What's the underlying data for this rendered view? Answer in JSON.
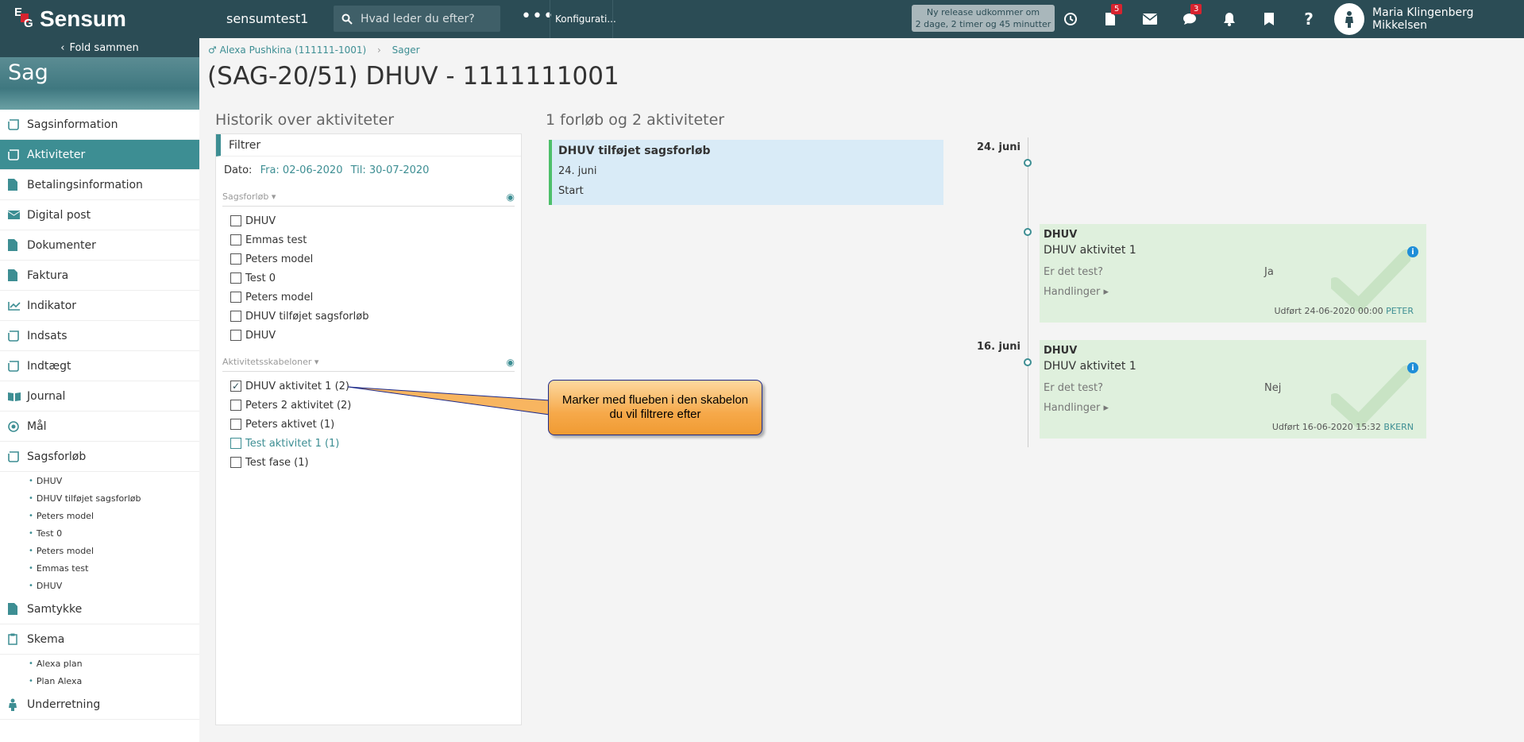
{
  "app": {
    "name": "Sensum",
    "tenant": "sensumtest1"
  },
  "topbar": {
    "search_placeholder": "Hvad leder du efter?",
    "more": "•••",
    "konfig": "Konfigurati...",
    "release_line1": "Ny release udkommer om",
    "release_line2": "2 dage, 2 timer og 45 minutter",
    "tasks_badge": "5",
    "chat_badge": "3",
    "user_name": "Maria Klingenberg Mikkelsen"
  },
  "sidebar": {
    "fold_label": "Fold sammen",
    "banner_title": "Sag",
    "items": [
      {
        "label": "Sagsinformation"
      },
      {
        "label": "Aktiviteter"
      },
      {
        "label": "Betalingsinformation"
      },
      {
        "label": "Digital post"
      },
      {
        "label": "Dokumenter"
      },
      {
        "label": "Faktura"
      },
      {
        "label": "Indikator"
      },
      {
        "label": "Indsats"
      },
      {
        "label": "Indtægt"
      },
      {
        "label": "Journal"
      },
      {
        "label": "Mål"
      },
      {
        "label": "Sagsforløb"
      },
      {
        "label": "Samtykke"
      },
      {
        "label": "Skema"
      },
      {
        "label": "Underretning"
      }
    ],
    "sagsforlob_sub": [
      "DHUV",
      "DHUV tilføjet sagsforløb",
      "Peters model",
      "Test 0",
      "Peters model",
      "Emmas test",
      "DHUV"
    ],
    "skema_sub": [
      "Alexa plan",
      "Plan Alexa"
    ]
  },
  "breadcrumb": {
    "person": "Alexa Pushkina (111111-1001)",
    "section": "Sager"
  },
  "page_title": "(SAG-20/51) DHUV - 1111111001",
  "history": {
    "title": "Historik over aktiviteter",
    "filter_label": "Filtrer",
    "dato_label": "Dato:",
    "dato_from": "Fra: 02-06-2020",
    "dato_to": "Til: 30-07-2020",
    "sagsforlob_header": "Sagsforløb",
    "sagsforlob_items": [
      "DHUV",
      "Emmas test",
      "Peters model",
      "Test 0",
      "Peters model",
      "DHUV tilføjet sagsforløb",
      "DHUV"
    ],
    "skabeloner_header": "Aktivitetsskabeloner",
    "skabeloner_items": [
      "DHUV aktivitet 1 (2)",
      "Peters 2 aktivitet (2)",
      "Peters aktivet (1)",
      "Test aktivitet 1 (1)",
      "Test fase (1)"
    ]
  },
  "callout": {
    "text": "Marker med flueben i den skabelon du vil filtrere efter"
  },
  "timeline": {
    "summary": "1 forløb og 2 aktiviteter",
    "forlob": {
      "title": "DHUV tilføjet sagsforløb",
      "date": "24. juni",
      "status": "Start"
    },
    "dates": [
      "24. juni",
      "16. juni"
    ],
    "activities": [
      {
        "header": "DHUV",
        "name": "DHUV aktivitet 1",
        "question": "Er det test?",
        "answer": "Ja",
        "actions": "Handlinger",
        "done": "Udført 24-06-2020 00:00",
        "who": "PETER"
      },
      {
        "header": "DHUV",
        "name": "DHUV aktivitet 1",
        "question": "Er det test?",
        "answer": "Nej",
        "actions": "Handlinger",
        "done": "Udført 16-06-2020 15:32",
        "who": "BKERN"
      }
    ]
  }
}
